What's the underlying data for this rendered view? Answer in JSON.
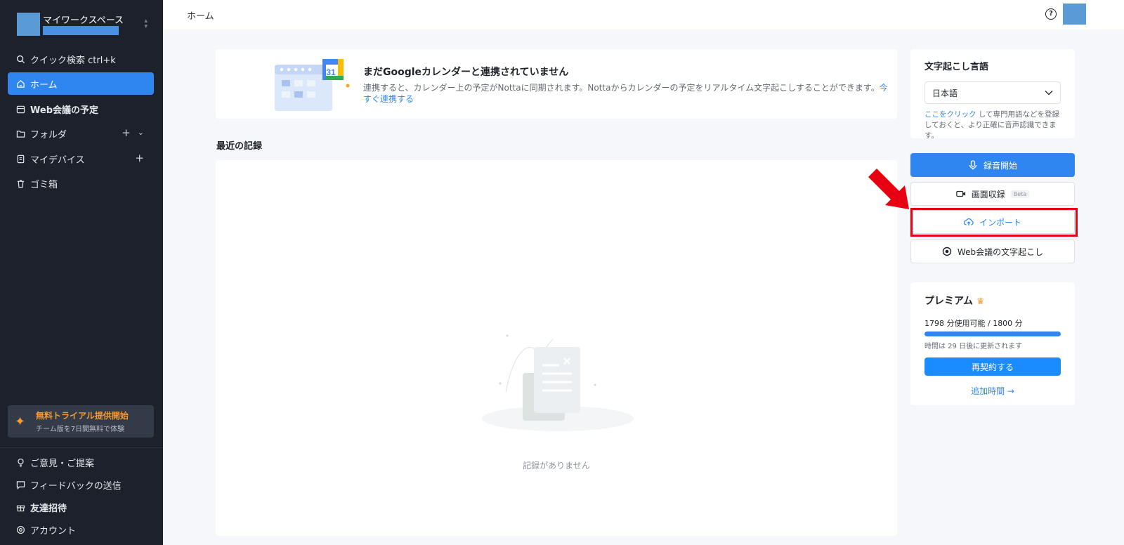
{
  "sidebar": {
    "workspace_name": "マイワークスペース",
    "items": [
      {
        "label": "クイック検索 ctrl+k"
      },
      {
        "label": "ホーム"
      },
      {
        "label": "Web会議の予定"
      },
      {
        "label": "フォルダ"
      },
      {
        "label": "マイデバイス"
      },
      {
        "label": "ゴミ箱"
      }
    ],
    "trial": {
      "title": "無料トライアル提供開始",
      "subtitle": "チーム版を7日間無料で体験"
    },
    "bottom_items": [
      {
        "label": "ご意見・ご提案"
      },
      {
        "label": "フィードバックの送信"
      },
      {
        "label": "友達招待"
      },
      {
        "label": "アカウント"
      }
    ]
  },
  "topbar": {
    "breadcrumb": "ホーム",
    "help_glyph": "?"
  },
  "calendar_banner": {
    "title": "まだGoogleカレンダーと連携されていません",
    "description": "連携すると、カレンダー上の予定がNottaに同期されます。Nottaからカレンダーの予定をリアルタイム文字起こしすることができます。",
    "link": "今すぐ連携する",
    "calendar_day": "31"
  },
  "recent": {
    "title": "最近の記録",
    "empty_text": "記録がありません"
  },
  "language": {
    "title": "文字起こし言語",
    "selected": "日本語",
    "hint_link": "ここをクリック",
    "hint_text": "して専門用語などを登録しておくと、より正確に音声認識できます。"
  },
  "actions": {
    "record": "録音開始",
    "screen": "画面収録",
    "screen_badge": "Beta",
    "import": "インポート",
    "meeting": "Web会議の文字起こし"
  },
  "premium": {
    "title": "プレミアム",
    "usage": "1798 分使用可能 / 1800 分",
    "usage_fraction": 0.9989,
    "reset": "時間は 29 日後に更新されます",
    "renew": "再契約する",
    "add_time": "追加時間 →"
  },
  "colors": {
    "accent": "#2f86f0",
    "sidebar": "#1c212b",
    "highlight": "#e60012",
    "trial": "#f39b32"
  }
}
